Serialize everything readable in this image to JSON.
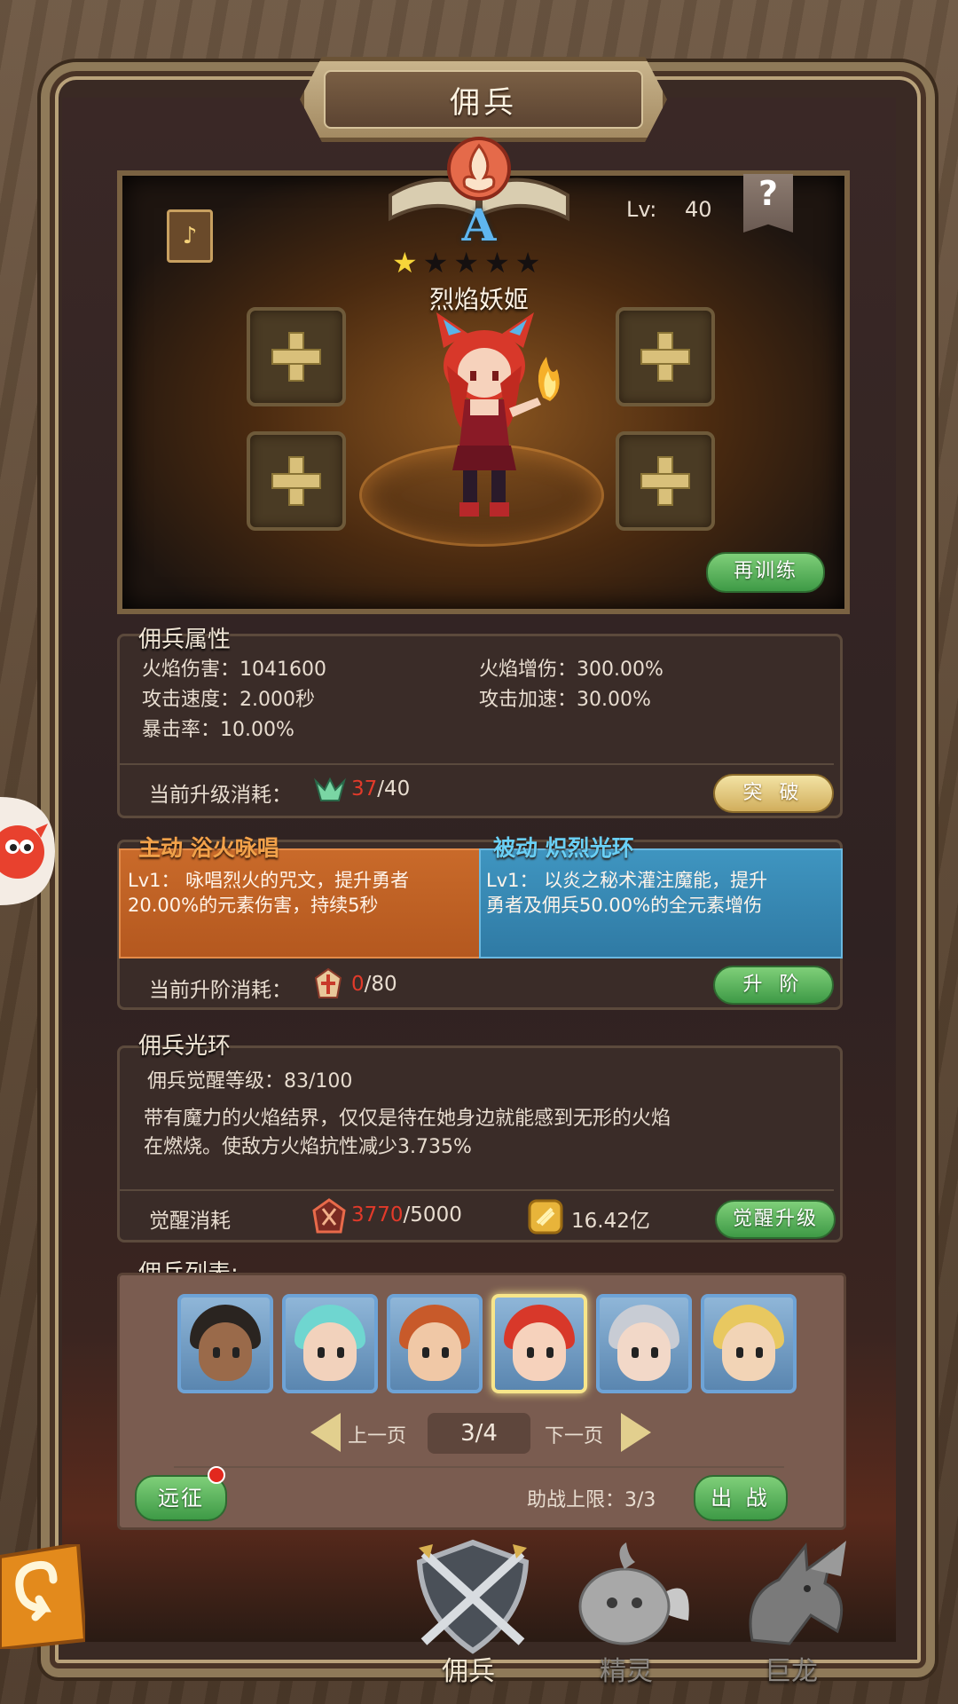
{
  "header": {
    "title": "佣兵"
  },
  "hero": {
    "grade": "A",
    "level_label": "Lv:",
    "level_value": "40",
    "help_label": "?",
    "stars_filled": 1,
    "stars_total": 5,
    "name": "烈焰妖姬",
    "retrain_label": "再训练",
    "equipment_slots": 4
  },
  "attributes": {
    "title": "佣兵属性",
    "stats_left": [
      "火焰伤害：1041600",
      "攻击速度：2.000秒",
      "暴击率：10.00%"
    ],
    "stats_right": [
      "火焰增伤：300.00%",
      "攻击加速：30.00%"
    ],
    "upgrade_cost_label": "当前升级消耗：",
    "upgrade_cost_current": "37",
    "upgrade_cost_max": "/40",
    "breakthrough_label": "突 破"
  },
  "skills": {
    "active_title": "主动 浴火咏唱",
    "active_desc_1": "Lv1： 咏唱烈火的咒文，提升勇者",
    "active_desc_2": "20.00%的元素伤害，持续5秒",
    "passive_title": "被动 炽烈光环",
    "passive_desc_1": "Lv1： 以炎之秘术灌注魔能，提升",
    "passive_desc_2": "勇者及佣兵50.00%的全元素增伤",
    "ascend_cost_label": "当前升阶消耗：",
    "ascend_cost_current": "0",
    "ascend_cost_max": "/80",
    "ascend_label": "升 阶"
  },
  "aura": {
    "title": "佣兵光环",
    "awaken_level": "佣兵觉醒等级：83/100",
    "desc_1": "带有魔力的火焰结界，仅仅是待在她身边就能感到无形的火焰",
    "desc_2": "在燃烧。使敌方火焰抗性减少3.735%",
    "cost_label": "觉醒消耗",
    "cost_current": "3770",
    "cost_max": "/5000",
    "gold_amount": "16.42亿",
    "awaken_button": "觉醒升级"
  },
  "roster": {
    "title": "佣兵列表:",
    "prev_label": "上一页",
    "next_label": "下一页",
    "page": "3/4",
    "expedition_label": "远征",
    "assist_limit": "助战上限：3/3",
    "deploy_label": "出 战",
    "portraits": [
      {
        "hair": "#2a2420",
        "skin": "#9a6a4a"
      },
      {
        "hair": "#6fd6d0",
        "skin": "#f2d2bc"
      },
      {
        "hair": "#c85a2a",
        "skin": "#f0c8a6"
      },
      {
        "hair": "#d8382a",
        "skin": "#f6d2bc"
      },
      {
        "hair": "#c8ccd4",
        "skin": "#f2d8c8"
      },
      {
        "hair": "#e8c860",
        "skin": "#f2d4b6"
      }
    ],
    "selected_index": 3
  },
  "bottom_nav": {
    "tabs": [
      "佣兵",
      "精灵",
      "巨龙"
    ],
    "active": 0
  },
  "colors": {
    "accent_green": "#3e9a46",
    "accent_gold": "#d1ae5c",
    "cost_red": "#e23a2a",
    "active_skill": "#c96a2a",
    "passive_skill": "#3f95c0"
  }
}
